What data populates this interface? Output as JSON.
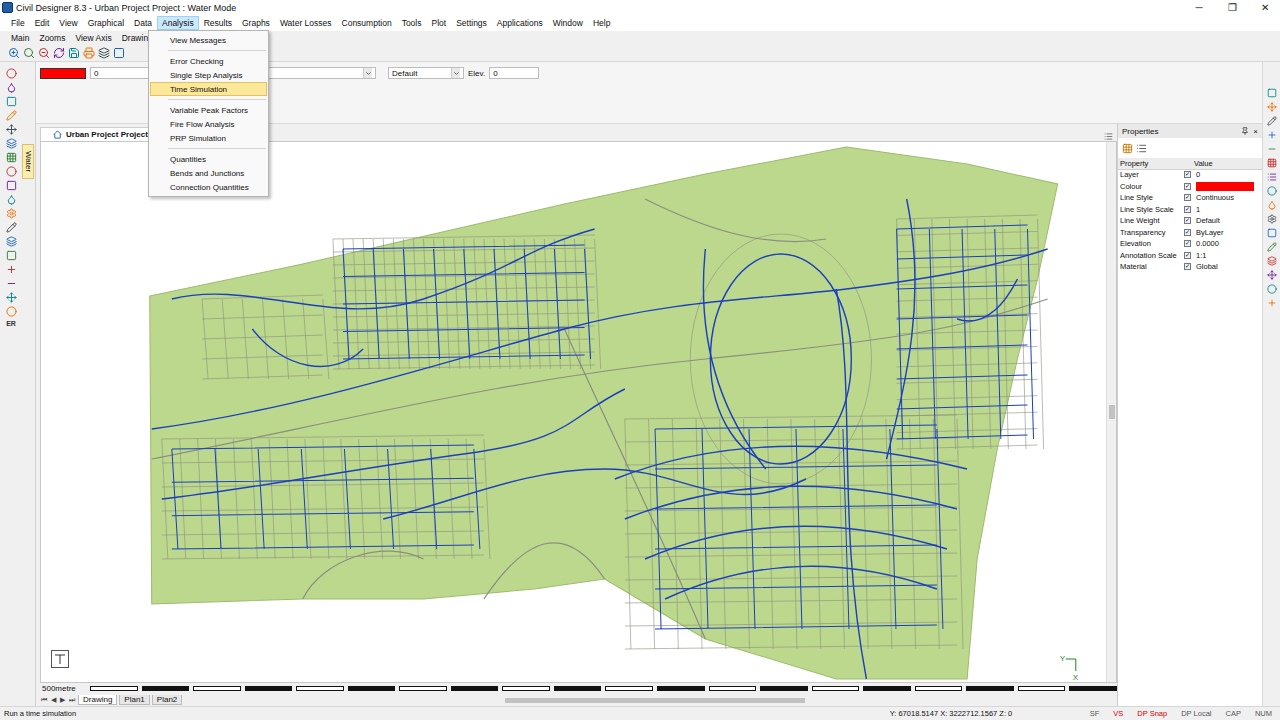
{
  "window": {
    "title": "Civil Designer 8.3 - Urban Project Project : Water Mode",
    "controls": [
      "─",
      "❐",
      "✕"
    ]
  },
  "menu_bar": [
    {
      "label": "File",
      "selected": false
    },
    {
      "label": "Edit",
      "selected": false
    },
    {
      "label": "View",
      "selected": false
    },
    {
      "label": "Graphical",
      "selected": false
    },
    {
      "label": "Data",
      "selected": false
    },
    {
      "label": "Analysis",
      "selected": true
    },
    {
      "label": "Results",
      "selected": false
    },
    {
      "label": "Graphs",
      "selected": false
    },
    {
      "label": "Water Losses",
      "selected": false
    },
    {
      "label": "Consumption",
      "selected": false
    },
    {
      "label": "Tools",
      "selected": false
    },
    {
      "label": "Plot",
      "selected": false
    },
    {
      "label": "Settings",
      "selected": false
    },
    {
      "label": "Applications",
      "selected": false
    },
    {
      "label": "Window",
      "selected": false
    },
    {
      "label": "Help",
      "selected": false
    }
  ],
  "analysis_menu": [
    {
      "kind": "item",
      "label": "View Messages",
      "selected": false
    },
    {
      "kind": "separator"
    },
    {
      "kind": "item",
      "label": "Error Checking",
      "selected": false
    },
    {
      "kind": "item",
      "label": "Single Step Analysis",
      "selected": false
    },
    {
      "kind": "item",
      "label": "Time Simulation",
      "selected": true
    },
    {
      "kind": "separator"
    },
    {
      "kind": "item",
      "label": "Variable Peak Factors",
      "selected": false
    },
    {
      "kind": "item",
      "label": "Fire Flow Analysis",
      "selected": false
    },
    {
      "kind": "item",
      "label": "PRP Simulation",
      "selected": false
    },
    {
      "kind": "separator"
    },
    {
      "kind": "item",
      "label": "Quantities",
      "selected": false
    },
    {
      "kind": "item",
      "label": "Bends and Junctions",
      "selected": false
    },
    {
      "kind": "item",
      "label": "Connection Quantities",
      "selected": false
    }
  ],
  "toolbar_tabs": [
    "Main",
    "Zooms",
    "View Axis",
    "Drawing"
  ],
  "property_bar": {
    "layer_colour": "#ff0000",
    "layer": "0",
    "material": "Default",
    "elevation_label": "Elev.",
    "elevation": "0"
  },
  "side_tab": "Water",
  "side_labels": [
    "ER"
  ],
  "document_tab": "Urban Project Project",
  "axis_labels": [
    "Y",
    "X"
  ],
  "scale_bar": "500metre",
  "sheet_nav": [
    "⏮",
    "◀",
    "▶",
    "⏭"
  ],
  "sheet_tabs": [
    {
      "label": "Drawing",
      "selected": true
    },
    {
      "label": "Plan1",
      "selected": false
    },
    {
      "label": "Plan2",
      "selected": false
    }
  ],
  "properties": {
    "title": "Properties",
    "close": "×",
    "columns": [
      "Property",
      "Value"
    ],
    "rows": [
      {
        "property": "Layer",
        "kind": "text",
        "value": "0",
        "checked": true
      },
      {
        "property": "Colour",
        "kind": "color",
        "color": "#ff0000",
        "checked": true
      },
      {
        "property": "Line Style",
        "kind": "text",
        "value": "Continuous",
        "checked": true
      },
      {
        "property": "Line Style Scale",
        "kind": "text",
        "value": "1",
        "checked": true
      },
      {
        "property": "Line Weight",
        "kind": "text",
        "value": "Default",
        "checked": true
      },
      {
        "property": "Transparency",
        "kind": "text",
        "value": "ByLayer",
        "checked": true
      },
      {
        "property": "Elevation",
        "kind": "text",
        "value": "0.0000",
        "checked": true
      },
      {
        "property": "Annotation Scale",
        "kind": "text",
        "value": "1:1",
        "checked": true
      },
      {
        "property": "Material",
        "kind": "text",
        "value": "Global",
        "checked": true
      }
    ]
  },
  "status_bar": {
    "message": "Run a time simulation",
    "coords": "Y: 67018.5147 X: 3222712.1567 Z: 0",
    "indicators": [
      {
        "label": "SF",
        "on": false
      },
      {
        "label": "VS",
        "on": true
      },
      {
        "label": "DP Snap",
        "on": true
      },
      {
        "label": "DP Local",
        "on": false
      },
      {
        "label": "CAP",
        "on": false
      },
      {
        "label": "NUM",
        "on": false
      }
    ]
  }
}
